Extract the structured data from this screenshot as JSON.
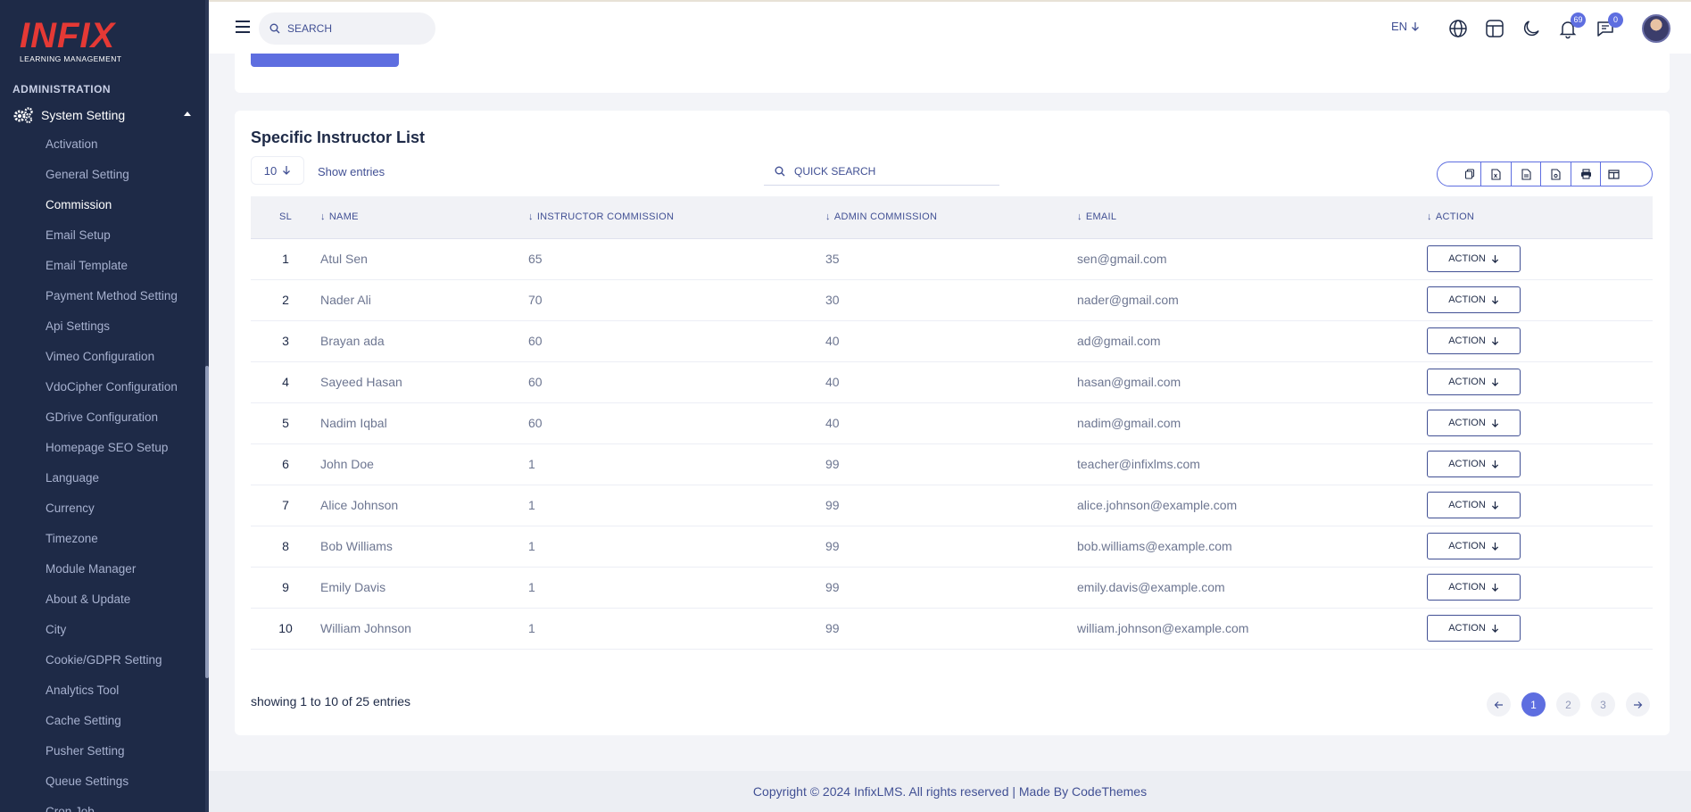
{
  "brand": {
    "logo_text": "INFIX",
    "logo_subtitle": "LEARNING MANAGEMENT"
  },
  "sidebar": {
    "section": "ADMINISTRATION",
    "parent": "System Setting",
    "items": [
      {
        "label": "Activation"
      },
      {
        "label": "General Setting"
      },
      {
        "label": "Commission",
        "active": true
      },
      {
        "label": "Email Setup"
      },
      {
        "label": "Email Template"
      },
      {
        "label": "Payment Method Setting"
      },
      {
        "label": "Api Settings"
      },
      {
        "label": "Vimeo Configuration"
      },
      {
        "label": "VdoCipher Configuration"
      },
      {
        "label": "GDrive Configuration"
      },
      {
        "label": "Homepage SEO Setup"
      },
      {
        "label": "Language"
      },
      {
        "label": "Currency"
      },
      {
        "label": "Timezone"
      },
      {
        "label": "Module Manager"
      },
      {
        "label": "About & Update"
      },
      {
        "label": "City"
      },
      {
        "label": "Cookie/GDPR Setting"
      },
      {
        "label": "Analytics Tool"
      },
      {
        "label": "Cache Setting"
      },
      {
        "label": "Pusher Setting"
      },
      {
        "label": "Queue Settings"
      },
      {
        "label": "Cron Job"
      }
    ]
  },
  "topbar": {
    "search_placeholder": "SEARCH",
    "language": "EN",
    "notifications_count": "69",
    "messages_count": "0"
  },
  "main": {
    "title": "Specific Instructor List",
    "entries_value": "10",
    "show_entries_label": "Show entries",
    "quick_search_placeholder": "QUICK SEARCH",
    "columns": [
      "SL",
      "NAME",
      "INSTRUCTOR COMMISSION",
      "ADMIN COMMISSION",
      "EMAIL",
      "ACTION"
    ],
    "action_label": "ACTION",
    "rows": [
      {
        "sl": "1",
        "name": "Atul Sen",
        "instructor": "65",
        "admin": "35",
        "email": "sen@gmail.com"
      },
      {
        "sl": "2",
        "name": "Nader Ali",
        "instructor": "70",
        "admin": "30",
        "email": "nader@gmail.com"
      },
      {
        "sl": "3",
        "name": "Brayan ada",
        "instructor": "60",
        "admin": "40",
        "email": "ad@gmail.com"
      },
      {
        "sl": "4",
        "name": "Sayeed Hasan",
        "instructor": "60",
        "admin": "40",
        "email": "hasan@gmail.com"
      },
      {
        "sl": "5",
        "name": "Nadim Iqbal",
        "instructor": "60",
        "admin": "40",
        "email": "nadim@gmail.com"
      },
      {
        "sl": "6",
        "name": "John Doe",
        "instructor": "1",
        "admin": "99",
        "email": "teacher@infixlms.com"
      },
      {
        "sl": "7",
        "name": "Alice Johnson",
        "instructor": "1",
        "admin": "99",
        "email": "alice.johnson@example.com"
      },
      {
        "sl": "8",
        "name": "Bob Williams",
        "instructor": "1",
        "admin": "99",
        "email": "bob.williams@example.com"
      },
      {
        "sl": "9",
        "name": "Emily Davis",
        "instructor": "1",
        "admin": "99",
        "email": "emily.davis@example.com"
      },
      {
        "sl": "10",
        "name": "William Johnson",
        "instructor": "1",
        "admin": "99",
        "email": "william.johnson@example.com"
      }
    ],
    "showing_text": "showing 1 to 10 of 25 entries",
    "pages": [
      "1",
      "2",
      "3"
    ],
    "current_page": "1"
  },
  "footer": {
    "text": "Copyright © 2024 InfixLMS. All rights reserved | Made By CodeThemes"
  },
  "colors": {
    "sidebar_bg": "#1e2a47",
    "accent": "#5e6ee0",
    "logo_red": "#e53935",
    "text": "#415094"
  }
}
